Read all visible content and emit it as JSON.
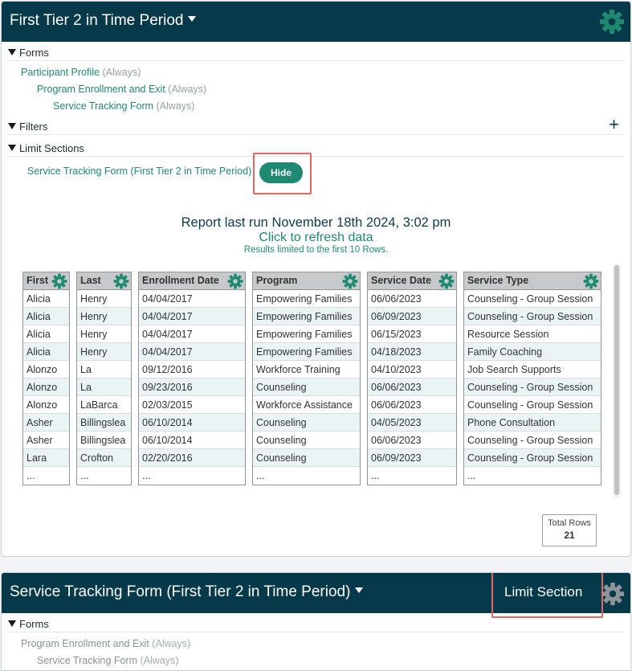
{
  "panel1": {
    "title": "First Tier 2 in Time Period",
    "sections": {
      "forms": "Forms",
      "filters": "Filters",
      "limit_sections": "Limit Sections"
    },
    "forms": [
      {
        "name": "Participant Profile",
        "qualifier": "(Always)"
      },
      {
        "name": "Program Enrollment and Exit",
        "qualifier": "(Always)"
      },
      {
        "name": "Service Tracking Form",
        "qualifier": "(Always)"
      }
    ],
    "limit_item": "Service Tracking Form (First Tier 2 in Time Period)",
    "hide_label": "Hide",
    "report_last_run": "Report last run November 18th 2024, 3:02 pm",
    "refresh_link": "Click to refresh data",
    "results_note": "Results limited to the first 10 Rows.",
    "columns": [
      {
        "header": "First",
        "rows": [
          "Alicia",
          "Alicia",
          "Alicia",
          "Alicia",
          "Alonzo",
          "Alonzo",
          "Alonzo",
          "Asher",
          "Asher",
          "Lara",
          "..."
        ]
      },
      {
        "header": "Last",
        "rows": [
          "Henry",
          "Henry",
          "Henry",
          "Henry",
          "La",
          "La",
          "LaBarca",
          "Billingslea",
          "Billingslea",
          "Crofton",
          "..."
        ]
      },
      {
        "header": "Enrollment Date",
        "rows": [
          "04/04/2017",
          "04/04/2017",
          "04/04/2017",
          "04/04/2017",
          "09/12/2016",
          "09/23/2016",
          "02/03/2015",
          "06/10/2014",
          "06/10/2014",
          "02/20/2016",
          "..."
        ]
      },
      {
        "header": "Program",
        "rows": [
          "Empowering Families",
          "Empowering Families",
          "Empowering Families",
          "Empowering Families",
          "Workforce Training",
          "Counseling",
          "Workforce Assistance",
          "Counseling",
          "Counseling",
          "Counseling",
          "..."
        ]
      },
      {
        "header": "Service Date",
        "rows": [
          "06/06/2023",
          "06/09/2023",
          "06/15/2023",
          "04/18/2023",
          "04/10/2023",
          "06/06/2023",
          "06/06/2023",
          "04/05/2023",
          "06/06/2023",
          "06/09/2023",
          "..."
        ]
      },
      {
        "header": "Service Type",
        "rows": [
          "Counseling - Group Session",
          "Counseling - Group Session",
          "Resource Session",
          "Family Coaching",
          "Job Search Supports",
          "Counseling - Group Session",
          "Counseling - Group Session",
          "Phone Consultation",
          "Counseling - Group Session",
          "Counseling - Group Session",
          "..."
        ]
      }
    ],
    "total_rows_label": "Total Rows",
    "total_rows_value": "21"
  },
  "panel2": {
    "title": "Service Tracking Form (First Tier 2 in Time Period)",
    "limit_section_label": "Limit Section",
    "forms_label": "Forms",
    "forms": [
      {
        "name": "Program Enrollment and Exit",
        "qualifier": "(Always)"
      },
      {
        "name": "Service Tracking Form",
        "qualifier": "(Always)"
      }
    ]
  },
  "colors": {
    "header_bg": "#063a4a",
    "accent": "#1f8a72",
    "highlight_box": "#e8675e",
    "row_alt": "#eaf4f4"
  }
}
